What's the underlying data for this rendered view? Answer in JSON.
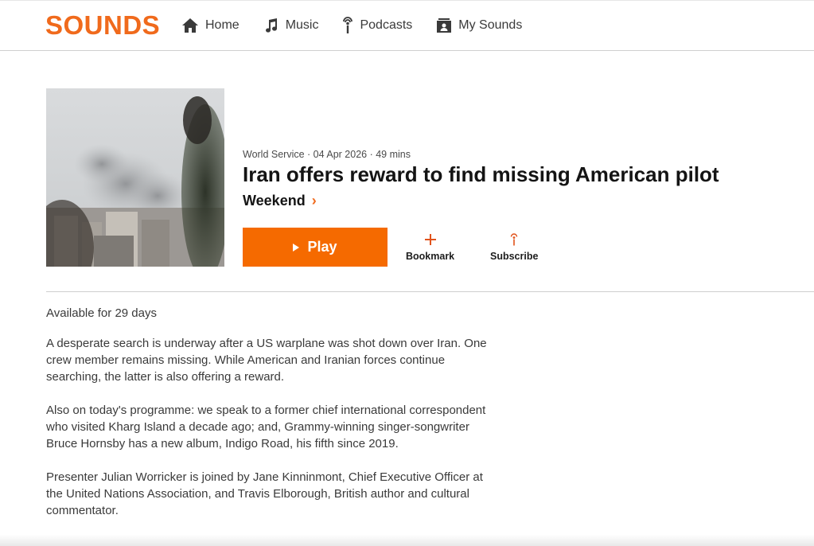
{
  "header": {
    "logo_text": "SOUNDS",
    "brand_color": "#f06a1c",
    "nav": [
      {
        "label": "Home",
        "icon": "home-icon"
      },
      {
        "label": "Music",
        "icon": "music-note-icon"
      },
      {
        "label": "Podcasts",
        "icon": "podcast-icon"
      },
      {
        "label": "My Sounds",
        "icon": "my-sounds-icon"
      }
    ]
  },
  "episode": {
    "meta": "World Service · 04 Apr 2026 · 49 mins",
    "title": "Iran offers reward to find missing American pilot",
    "brand": "Weekend",
    "play_label": "Play",
    "bookmark_label": "Bookmark",
    "subscribe_label": "Subscribe",
    "availability": "Available for 29 days",
    "description": [
      "A desperate search is underway after a US warplane was shot down over Iran. One crew member remains missing. While American and Iranian forces continue searching, the latter is also offering a reward.",
      "Also on today's programme: we speak to a former chief international correspondent who visited Kharg Island a decade ago; and, Grammy-winning singer-songwriter Bruce Hornsby has a new album, Indigo Road, his fifth since 2019.",
      "Presenter Julian Worricker is joined by Jane Kinninmont, Chief Executive Officer at the United Nations Association, and Travis Elborough, British author and cultural commentator."
    ]
  },
  "colors": {
    "accent": "#f56a00",
    "text": "#141414",
    "muted": "#4a4a4a"
  }
}
